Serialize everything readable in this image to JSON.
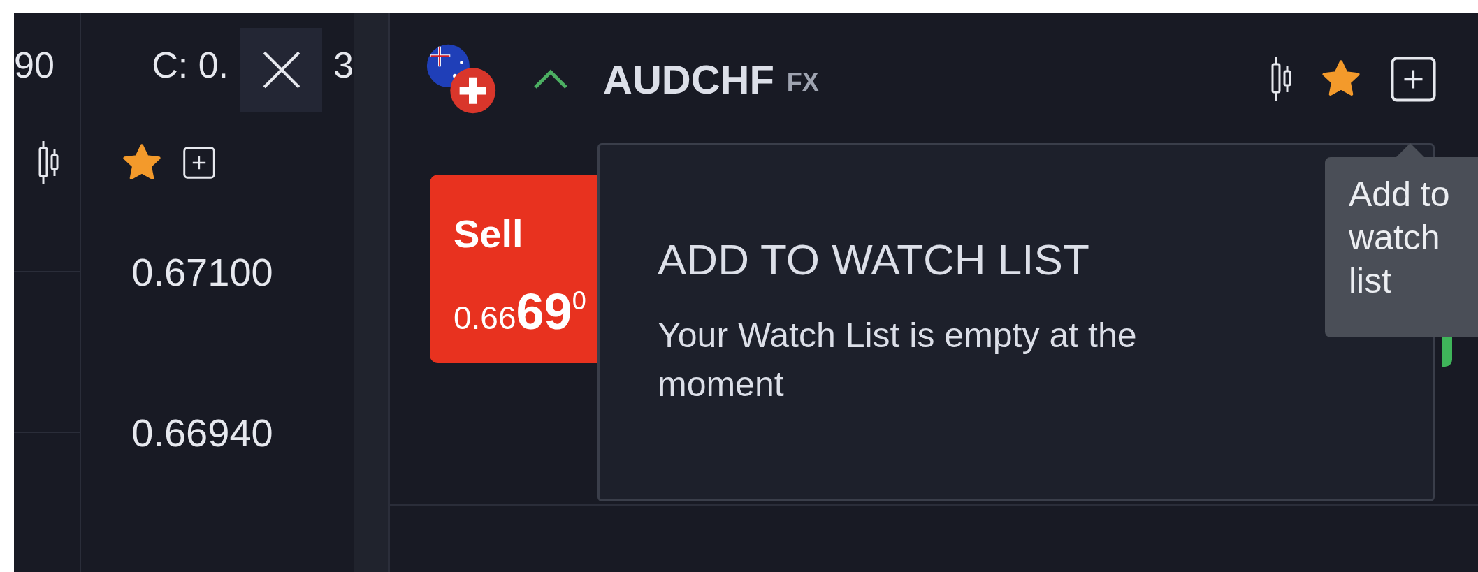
{
  "left_panel": {
    "column_1": {
      "value": "90"
    },
    "column_2": {
      "stat": "C: 0.",
      "stat_tail": "3",
      "favorite": true,
      "prices": [
        "0.67100",
        "0.66940"
      ]
    }
  },
  "instrument": {
    "symbol": "AUDCHF",
    "market": "FX",
    "rising": true,
    "favorite": true
  },
  "sell": {
    "label": "Sell",
    "price_prefix": "0.66",
    "price_main": "69",
    "price_sup": "0"
  },
  "watch_list_popup": {
    "title": "ADD TO WATCH LIST",
    "message": "Your Watch List is empty at the moment"
  },
  "tooltip": {
    "text": "Add to watch list"
  }
}
